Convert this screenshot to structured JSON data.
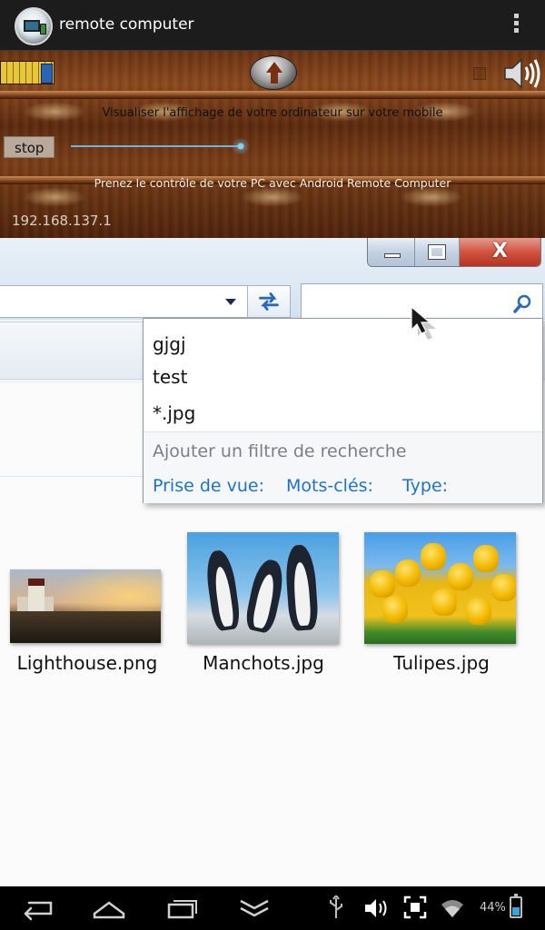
{
  "app_bar": {
    "title": "remote computer",
    "icons": {
      "app": "remote-computer-app-icon",
      "menu": "overflow-menu-icon"
    }
  },
  "control_panel": {
    "message_top": "Visualiser l'affichage de votre ordinateur sur votre mobile",
    "stop_label": "stop",
    "message_bottom": "Prenez le contrôle de votre PC avec Android Remote Computer",
    "ip_address": "192.168.137.1",
    "icons": {
      "keyboard": "keyboard-icon",
      "upload": "upload-arrow-icon",
      "sound": "speaker-icon"
    }
  },
  "remote_window": {
    "search_dropdown": {
      "history": [
        "gjgj",
        "test",
        "*.jpg"
      ],
      "hint": "Ajouter un filtre de recherche",
      "filters": [
        "Prise de vue:",
        "Mots-clés:",
        "Type:"
      ]
    },
    "files": [
      {
        "name": "Lighthouse.png",
        "thumb": "lighthouse-thumbnail"
      },
      {
        "name": "Manchots.jpg",
        "thumb": "penguins-thumbnail"
      },
      {
        "name": "Tulipes.jpg",
        "thumb": "tulips-thumbnail"
      }
    ]
  },
  "nav_bar": {
    "battery": "44%",
    "icons": [
      "back-icon",
      "home-icon",
      "recent-apps-icon",
      "hide-keyboard-icon",
      "usb-icon",
      "volume-icon",
      "screenshot-icon",
      "wifi-icon",
      "battery-icon"
    ]
  }
}
